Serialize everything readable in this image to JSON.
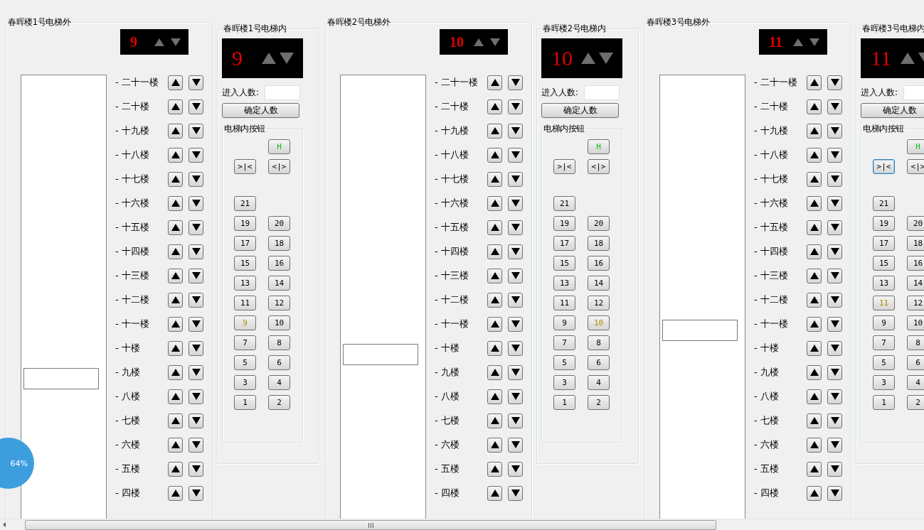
{
  "elevators": [
    {
      "outside": {
        "title": "春晖楼1号电梯外",
        "display": {
          "floor": "9",
          "up_lit": false,
          "down_lit": false
        },
        "car": {
          "level": 0.4
        },
        "floors": [
          "- 二十一楼",
          "- 二十楼",
          "- 十九楼",
          "- 十八楼",
          "- 十七楼",
          "- 十六楼",
          "- 十五楼",
          "- 十四楼",
          "- 十三楼",
          "- 十二楼",
          "- 十一楼",
          "- 十楼",
          "- 九楼",
          "- 八楼",
          "- 七楼",
          "- 六楼",
          "- 五楼",
          "- 四楼"
        ]
      },
      "inside": {
        "title": "春晖楼1号电梯内",
        "display": {
          "floor": "9",
          "up_lit": false,
          "down_lit": false
        },
        "count_label": "进入人数:",
        "confirm_button": "确定人数",
        "buttons_title": "电梯内按钮",
        "alarm_button": "H",
        "door_buttons": [
          {
            "label": ">|<",
            "focused": false
          },
          {
            "label": "<|>",
            "focused": false
          }
        ],
        "floor_buttons": [
          {
            "label": "21",
            "lit": false
          },
          {
            "label": "19",
            "lit": false
          },
          {
            "label": "20",
            "lit": false
          },
          {
            "label": "17",
            "lit": false
          },
          {
            "label": "18",
            "lit": false
          },
          {
            "label": "15",
            "lit": false
          },
          {
            "label": "16",
            "lit": false
          },
          {
            "label": "13",
            "lit": false
          },
          {
            "label": "14",
            "lit": false
          },
          {
            "label": "11",
            "lit": false
          },
          {
            "label": "12",
            "lit": false
          },
          {
            "label": "9",
            "lit": true
          },
          {
            "label": "10",
            "lit": false
          },
          {
            "label": "7",
            "lit": false
          },
          {
            "label": "8",
            "lit": false
          },
          {
            "label": "5",
            "lit": false
          },
          {
            "label": "6",
            "lit": false
          },
          {
            "label": "3",
            "lit": false
          },
          {
            "label": "4",
            "lit": false
          },
          {
            "label": "1",
            "lit": false
          },
          {
            "label": "2",
            "lit": false
          }
        ]
      }
    },
    {
      "outside": {
        "title": "春晖楼2号电梯外",
        "display": {
          "floor": "10",
          "up_lit": false,
          "down_lit": false
        },
        "car": {
          "level": 0.45
        },
        "floors": [
          "- 二十一楼",
          "- 二十楼",
          "- 十九楼",
          "- 十八楼",
          "- 十七楼",
          "- 十六楼",
          "- 十五楼",
          "- 十四楼",
          "- 十三楼",
          "- 十二楼",
          "- 十一楼",
          "- 十楼",
          "- 九楼",
          "- 八楼",
          "- 七楼",
          "- 六楼",
          "- 五楼",
          "- 四楼"
        ]
      },
      "inside": {
        "title": "春晖楼2号电梯内",
        "display": {
          "floor": "10",
          "up_lit": false,
          "down_lit": false
        },
        "count_label": "进入人数:",
        "confirm_button": "确定人数",
        "buttons_title": "电梯内按钮",
        "alarm_button": "H",
        "door_buttons": [
          {
            "label": ">|<",
            "focused": false
          },
          {
            "label": "<|>",
            "focused": false
          }
        ],
        "floor_buttons": [
          {
            "label": "21",
            "lit": false
          },
          {
            "label": "19",
            "lit": false
          },
          {
            "label": "20",
            "lit": false
          },
          {
            "label": "17",
            "lit": false
          },
          {
            "label": "18",
            "lit": false
          },
          {
            "label": "15",
            "lit": false
          },
          {
            "label": "16",
            "lit": false
          },
          {
            "label": "13",
            "lit": false
          },
          {
            "label": "14",
            "lit": false
          },
          {
            "label": "11",
            "lit": false
          },
          {
            "label": "12",
            "lit": false
          },
          {
            "label": "9",
            "lit": false
          },
          {
            "label": "10",
            "lit": true
          },
          {
            "label": "7",
            "lit": false
          },
          {
            "label": "8",
            "lit": false
          },
          {
            "label": "5",
            "lit": false
          },
          {
            "label": "6",
            "lit": false
          },
          {
            "label": "3",
            "lit": false
          },
          {
            "label": "4",
            "lit": false
          },
          {
            "label": "1",
            "lit": false
          },
          {
            "label": "2",
            "lit": false
          }
        ]
      }
    },
    {
      "outside": {
        "title": "春晖楼3号电梯外",
        "display": {
          "floor": "11",
          "up_lit": false,
          "down_lit": false
        },
        "car": {
          "level": 0.5
        },
        "floors": [
          "- 二十一楼",
          "- 二十楼",
          "- 十九楼",
          "- 十八楼",
          "- 十七楼",
          "- 十六楼",
          "- 十五楼",
          "- 十四楼",
          "- 十三楼",
          "- 十二楼",
          "- 十一楼",
          "- 十楼",
          "- 九楼",
          "- 八楼",
          "- 七楼",
          "- 六楼",
          "- 五楼",
          "- 四楼"
        ]
      },
      "inside": {
        "title": "春晖楼3号电梯内",
        "display": {
          "floor": "11",
          "up_lit": false,
          "down_lit": false
        },
        "count_label": "进入人数:",
        "confirm_button": "确定人数",
        "buttons_title": "电梯内按钮",
        "alarm_button": "H",
        "door_buttons": [
          {
            "label": ">|<",
            "focused": true
          },
          {
            "label": "<|>",
            "focused": false
          }
        ],
        "floor_buttons": [
          {
            "label": "21",
            "lit": false
          },
          {
            "label": "19",
            "lit": false
          },
          {
            "label": "20",
            "lit": false
          },
          {
            "label": "17",
            "lit": false
          },
          {
            "label": "18",
            "lit": false
          },
          {
            "label": "15",
            "lit": false
          },
          {
            "label": "16",
            "lit": false
          },
          {
            "label": "13",
            "lit": false
          },
          {
            "label": "14",
            "lit": false
          },
          {
            "label": "11",
            "lit": true
          },
          {
            "label": "12",
            "lit": false
          },
          {
            "label": "9",
            "lit": false
          },
          {
            "label": "10",
            "lit": false
          },
          {
            "label": "7",
            "lit": false
          },
          {
            "label": "8",
            "lit": false
          },
          {
            "label": "5",
            "lit": false
          },
          {
            "label": "6",
            "lit": false
          },
          {
            "label": "3",
            "lit": false
          },
          {
            "label": "4",
            "lit": false
          },
          {
            "label": "1",
            "lit": false
          },
          {
            "label": "2",
            "lit": false
          }
        ]
      }
    }
  ],
  "progress_badge": "64%"
}
